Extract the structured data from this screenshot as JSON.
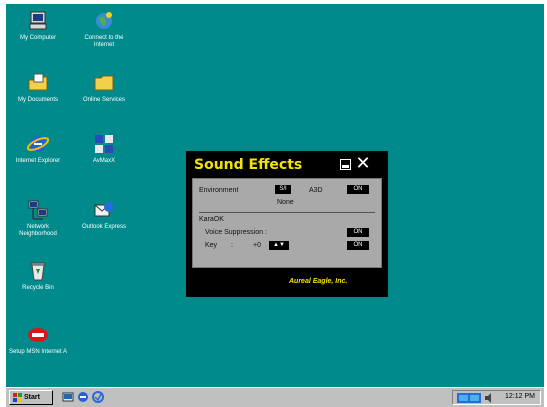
{
  "desktop": {
    "background": "#008a8c",
    "icons": [
      {
        "label": "My Computer",
        "icon": "my-computer-icon"
      },
      {
        "label": "Connect to the Internet",
        "icon": "connect-internet-icon"
      },
      {
        "label": "My Documents",
        "icon": "my-documents-icon"
      },
      {
        "label": "Online Services",
        "icon": "online-services-icon"
      },
      {
        "label": "Internet Explorer",
        "icon": "internet-explorer-icon"
      },
      {
        "label": "AvMaxX",
        "icon": "avmaxx-icon"
      },
      {
        "label": "Network Neighborhood",
        "icon": "network-neighborhood-icon"
      },
      {
        "label": "Outlook Express",
        "icon": "outlook-express-icon"
      },
      {
        "label": "Recycle Bin",
        "icon": "recycle-bin-icon"
      },
      {
        "label": "Setup MSN Internet A",
        "icon": "msn-setup-icon"
      }
    ]
  },
  "sound_effects": {
    "title": "Sound Effects",
    "environment_label": "Environment",
    "environment_button": "S/I",
    "environment_value": "None",
    "a3d_label": "A3D",
    "a3d_button": "ON",
    "karaoke_label": "KaraOK",
    "voice_label": "Voice Suppression :",
    "voice_button": "ON",
    "key_label": "Key",
    "key_colon": ":",
    "key_value": "+0",
    "key_button": "▲▼",
    "key_on_button": "ON",
    "footer": "Aureal Eagle, Inc.",
    "accent": "#f4e400"
  },
  "taskbar": {
    "start_label": "Start",
    "clock": "12:12 PM"
  }
}
